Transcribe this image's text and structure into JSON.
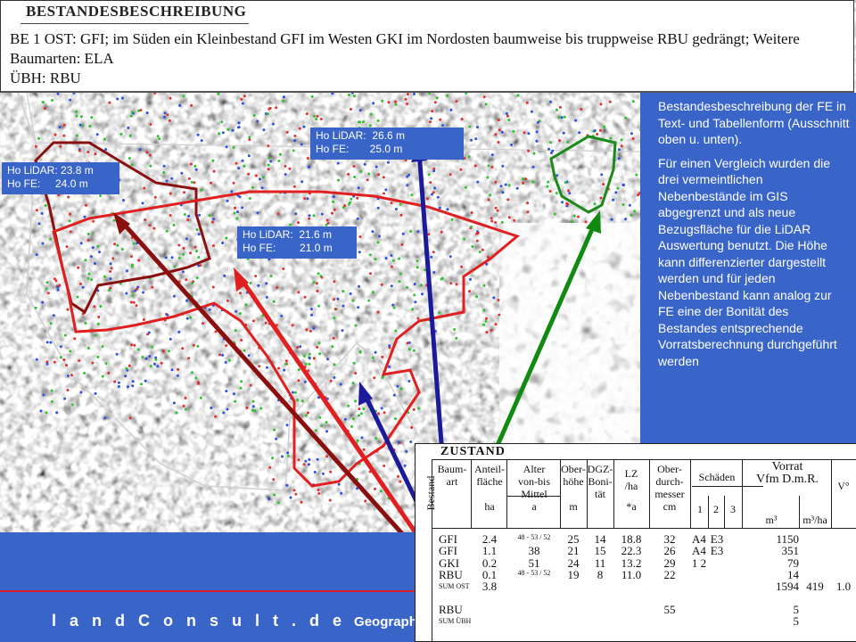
{
  "description": {
    "title": "BESTANDESBESCHREIBUNG",
    "lines": [
      "BE 1  OST: GFI;  im Süden  ein Kleinbestand  GFI  im Westen  GKI  im Nordosten  baumweise bis truppweise  RBU  gedrängt; Weitere",
      "Baumarten:  ELA",
      "ÜBH:  RBU"
    ]
  },
  "side_panel": {
    "para1": "Bestandesbeschreibung der FE in Text- und Tabellenform (Ausschnitt oben u. unten).",
    "para2": "Für einen Vergleich wurden die drei vermeintlichen Nebenbestände im GIS abgegrenzt und als neue Bezugsfläche für die LiDAR Auswertung benutzt. Die Höhe kann differenzierter dargestellt werden und für jeden Nebenbestand kann analog zur FE eine der Bonität des Bestandes entsprechende Vorratsberechnung durchgeführt werden"
  },
  "labels": {
    "west": {
      "lidar": "Ho LiDAR: 23.8 m",
      "fe": "Ho FE:     24.0 m"
    },
    "north": {
      "lidar": "Ho LiDAR:  26.6 m",
      "fe": "Ho FE:       25.0 m"
    },
    "center": {
      "lidar": "Ho LiDAR:  21.6 m",
      "fe": "Ho FE:        21.0 m"
    }
  },
  "footer": {
    "brand": "l a n d C o n s u l t . d e",
    "subtitle": "Geographic Informat"
  },
  "table": {
    "title": "ZUSTAND",
    "side_label": "Bestand",
    "headers": {
      "baumart": [
        "Baum-",
        "art"
      ],
      "anteil": [
        "Anteil-",
        "fläche",
        "ha"
      ],
      "alter": [
        "Alter",
        "von-bis",
        "Mittel",
        "a"
      ],
      "oberhoehe": [
        "Ober-",
        "höhe",
        "m"
      ],
      "dgz": [
        "DGZ-",
        "Boni-",
        "tät"
      ],
      "lz": [
        "LZ",
        "/ha",
        "*a"
      ],
      "durchmesser": [
        "Ober-",
        "durch-",
        "messer",
        "cm"
      ],
      "schaeden": "Schäden",
      "schaeden_cols": [
        "1",
        "2",
        "3"
      ],
      "vorrat": [
        "Vorrat",
        "Vfm D.m.R."
      ],
      "vorrat_units": [
        "m³",
        "m³/ha"
      ],
      "v": "V°"
    },
    "rows": [
      {
        "art": "GFI",
        "anteil": "2.4",
        "alter_range": "48 - 53 / 52",
        "alter": "",
        "hoehe": "25",
        "dgz": "14",
        "lz": "18.8",
        "dm": "32",
        "s1": "A4",
        "s2": "E3",
        "vorrat": "1150",
        "vha": "",
        "v": ""
      },
      {
        "art": "GFI",
        "anteil": "1.1",
        "alter_range": "",
        "alter": "38",
        "hoehe": "21",
        "dgz": "15",
        "lz": "22.3",
        "dm": "26",
        "s1": "A4",
        "s2": "E3",
        "vorrat": "351",
        "vha": "",
        "v": ""
      },
      {
        "art": "GKI",
        "anteil": "0.2",
        "alter_range": "",
        "alter": "51",
        "hoehe": "24",
        "dgz": "11",
        "lz": "13.2",
        "dm": "29",
        "s1": "1 2",
        "s2": "",
        "vorrat": "79",
        "vha": "",
        "v": ""
      },
      {
        "art": "RBU",
        "anteil": "0.1",
        "alter_range": "48 - 53 / 52",
        "alter": "",
        "hoehe": "19",
        "dgz": "8",
        "lz": "11.0",
        "dm": "22",
        "s1": "",
        "s2": "",
        "vorrat": "14",
        "vha": "",
        "v": ""
      },
      {
        "art": "SUM OST",
        "anteil": "3.8",
        "alter_range": "",
        "alter": "",
        "hoehe": "",
        "dgz": "",
        "lz": "",
        "dm": "",
        "s1": "",
        "s2": "",
        "vorrat": "1594",
        "vha": "419",
        "v": "1.0"
      },
      {
        "art": "RBU",
        "anteil": "",
        "alter_range": "",
        "alter": "",
        "hoehe": "",
        "dgz": "",
        "lz": "",
        "dm": "55",
        "s1": "",
        "s2": "",
        "vorrat": "5",
        "vha": "",
        "v": ""
      },
      {
        "art": "SUM ÜBH",
        "anteil": "",
        "alter_range": "",
        "alter": "",
        "hoehe": "",
        "dgz": "",
        "lz": "",
        "dm": "",
        "s1": "",
        "s2": "",
        "vorrat": "5",
        "vha": "",
        "v": ""
      }
    ]
  },
  "colors": {
    "panel_blue": "#3a65c8",
    "polygon_red": "#e02020",
    "polygon_darkred": "#8a1010",
    "polygon_green": "#1a8a1a",
    "arrow_blue": "#1a1a9a",
    "arrow_red": "#e02020",
    "arrow_darkred": "#8a1010",
    "arrow_green": "#118a11"
  }
}
